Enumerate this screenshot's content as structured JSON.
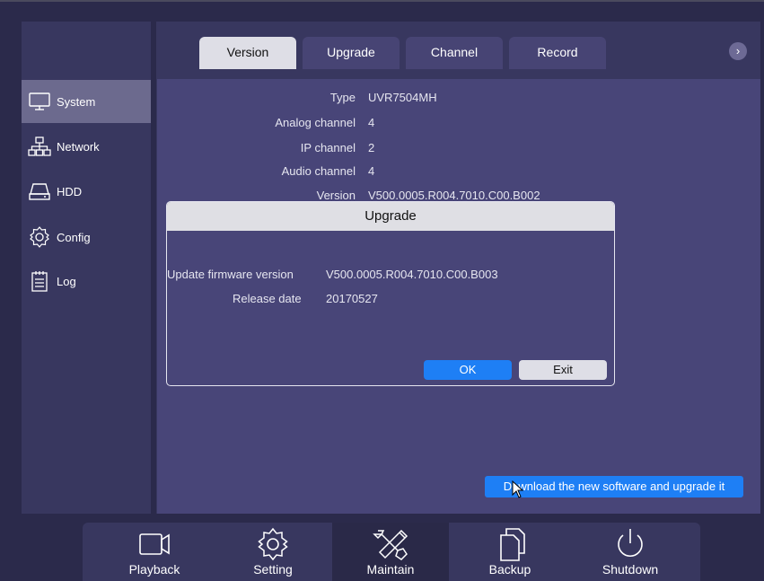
{
  "tabs": [
    {
      "label": "Version",
      "active": true
    },
    {
      "label": "Upgrade",
      "active": false
    },
    {
      "label": "Channel",
      "active": false
    },
    {
      "label": "Record",
      "active": false
    }
  ],
  "tab_next_glyph": "›",
  "sidebar": {
    "items": [
      {
        "label": "System",
        "icon": "monitor-icon",
        "active": true
      },
      {
        "label": "Network",
        "icon": "network-icon",
        "active": false
      },
      {
        "label": "HDD",
        "icon": "hdd-icon",
        "active": false
      },
      {
        "label": "Config",
        "icon": "gear-icon",
        "active": false
      },
      {
        "label": "Log",
        "icon": "log-icon",
        "active": false
      }
    ]
  },
  "info": {
    "type_label": "Type",
    "type_value": "UVR7504MH",
    "analog_label": "Analog channel",
    "analog_value": "4",
    "ip_label": "IP channel",
    "ip_value": "2",
    "audio_label": "Audio channel",
    "audio_value": "4",
    "version_label": "Version",
    "version_value": "V500.0005.R004.7010.C00.B002"
  },
  "dialog": {
    "title": "Upgrade",
    "firmware_label": "Update firmware version",
    "firmware_value": "V500.0005.R004.7010.C00.B003",
    "release_label": "Release date",
    "release_value": "20170527",
    "ok_label": "OK",
    "exit_label": "Exit"
  },
  "download_label": "Download the new software and upgrade it",
  "bottom_nav": [
    {
      "label": "Playback",
      "icon": "camera-icon",
      "active": false
    },
    {
      "label": "Setting",
      "icon": "gear-icon",
      "active": false
    },
    {
      "label": "Maintain",
      "icon": "tools-icon",
      "active": true
    },
    {
      "label": "Backup",
      "icon": "files-icon",
      "active": false
    },
    {
      "label": "Shutdown",
      "icon": "power-icon",
      "active": false
    }
  ],
  "colors": {
    "accent": "#1e7ff5",
    "panel": "#484578",
    "sidebar": "#38375f",
    "background": "#2b2a4b"
  }
}
